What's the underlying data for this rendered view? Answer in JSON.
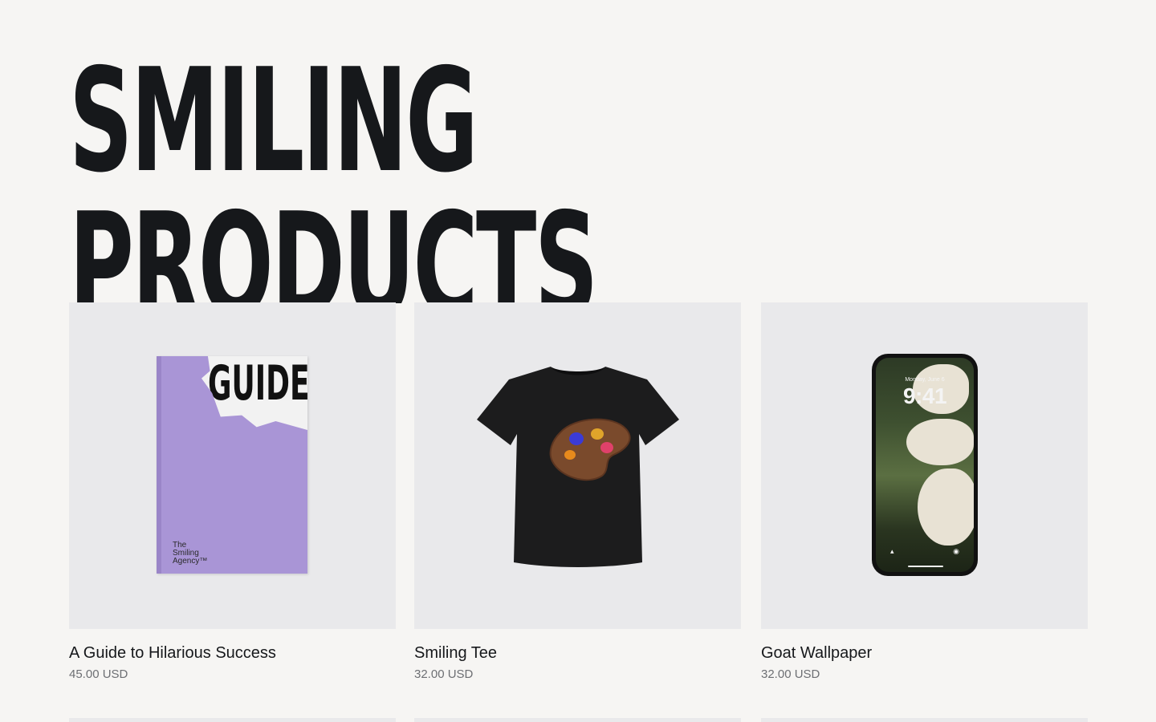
{
  "hero": {
    "line1": "SMILING",
    "line2": "PRODUCTS"
  },
  "products": [
    {
      "title": "A Guide to Hilarious Success",
      "price": "45.00 USD",
      "cover_text": "GUIDE TO",
      "publisher": [
        "The",
        "Smiling",
        "Agency™"
      ]
    },
    {
      "title": "Smiling Tee",
      "price": "32.00 USD"
    },
    {
      "title": "Goat Wallpaper",
      "price": "32.00 USD",
      "lock_date": "Monday, June 6",
      "lock_time": "9:41"
    }
  ],
  "colors": {
    "background": "#f6f5f3",
    "card_bg": "#e9e9eb",
    "text": "#16181b",
    "muted": "#6d6f73",
    "book_cover": "#a995d6"
  }
}
